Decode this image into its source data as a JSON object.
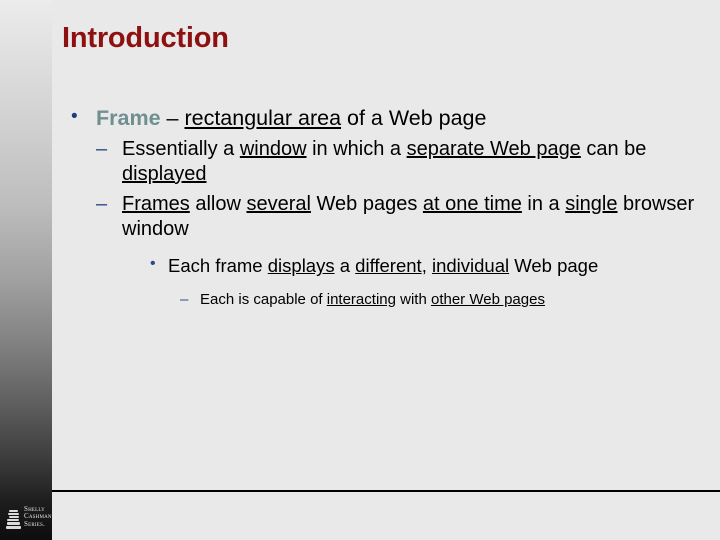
{
  "slide": {
    "title": "Introduction",
    "title_color": "#8e1111",
    "background_color": "#e9e9e9",
    "accent_keyword_color": "#6f8f90",
    "bullet_marker_color": "#2b4a86"
  },
  "bullets": {
    "level1": {
      "marker": "•",
      "keyword": "Frame",
      "dash": " – ",
      "underlined": "rectangular area",
      "tail": " of a Web page"
    },
    "level2_a": {
      "marker": "–",
      "p1": "Essentially a ",
      "u1": "window",
      "p2": " in which a ",
      "u2": "separate Web page",
      "p3": " can be ",
      "u3": "displayed"
    },
    "level2_b": {
      "marker": "–",
      "u1": "Frames",
      "p1": " allow ",
      "u2": "several",
      "p2": " Web pages ",
      "u3": "at one time",
      "p3": " in a ",
      "u4": "single",
      "p4": " browser window"
    },
    "level3": {
      "marker": "•",
      "p1": "Each frame ",
      "u1": "displays",
      "p2": " a ",
      "u2": "different",
      "p3": ", ",
      "u3": "individual",
      "p4": " Web page"
    },
    "level4": {
      "marker": "–",
      "p1": "Each is capable of ",
      "u1": "interacting",
      "p2": " with ",
      "u2": "other Web pages"
    }
  },
  "logo": {
    "icon": "book-stack-icon",
    "line1": "Shelly",
    "line2": "Cashman",
    "line3": "Series."
  }
}
